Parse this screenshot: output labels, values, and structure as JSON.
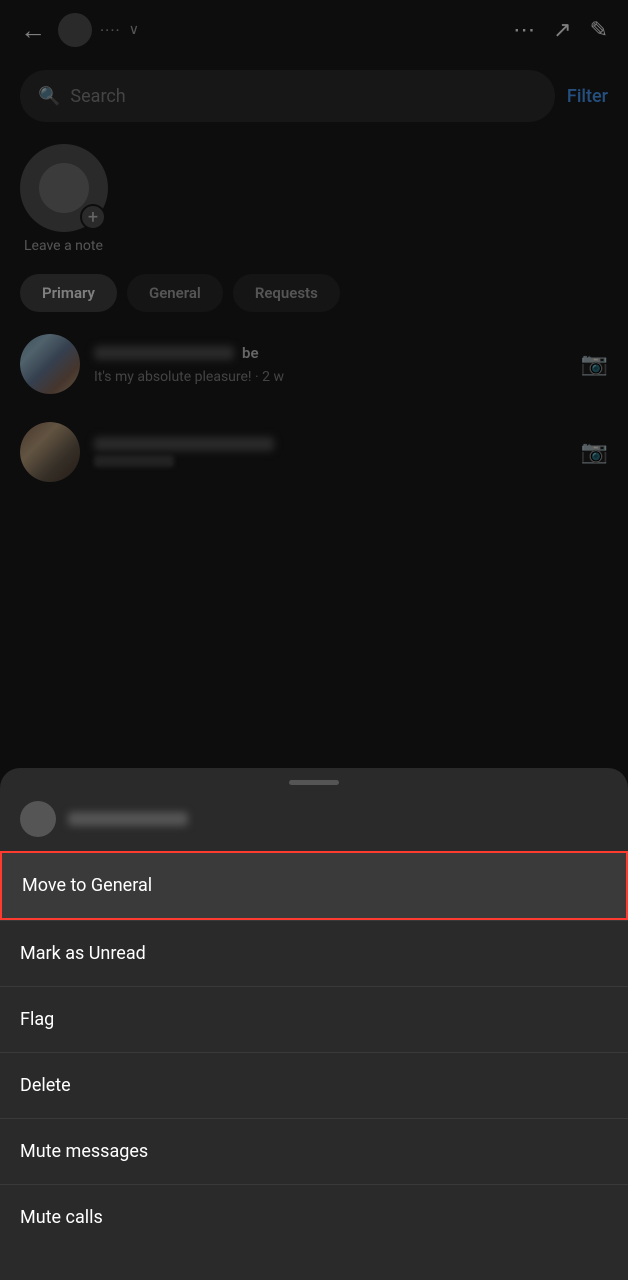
{
  "statusBar": {
    "backLabel": "←",
    "titleBlur": "····",
    "moreIcon": "⋯",
    "trendIcon": "↗",
    "editIcon": "✎"
  },
  "search": {
    "placeholder": "Search",
    "filterLabel": "Filter"
  },
  "note": {
    "label": "Leave a note",
    "plusLabel": "+"
  },
  "tabs": [
    {
      "label": "Primary",
      "active": true
    },
    {
      "label": "General",
      "active": false
    },
    {
      "label": "Requests",
      "active": false
    }
  ],
  "messages": [
    {
      "nameEnd": "be",
      "preview": "It's my absolute pleasure! · 2 w",
      "hasCamera": true
    },
    {
      "nameEnd": "",
      "preview": "",
      "hasCamera": true
    }
  ],
  "bottomSheet": {
    "headerNameBlur": true,
    "menuItems": [
      {
        "label": "Move to General",
        "highlighted": true
      },
      {
        "label": "Mark as Unread",
        "highlighted": false
      },
      {
        "label": "Flag",
        "highlighted": false
      },
      {
        "label": "Delete",
        "highlighted": false
      },
      {
        "label": "Mute messages",
        "highlighted": false
      },
      {
        "label": "Mute calls",
        "highlighted": false
      }
    ]
  }
}
